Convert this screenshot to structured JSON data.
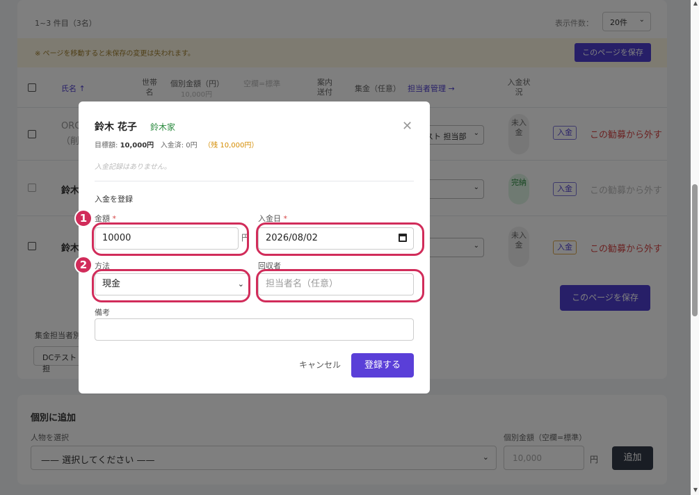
{
  "list": {
    "count_text": "1~3 件目（3名）",
    "per_page_label": "表示件数：",
    "per_page_value": "20件",
    "warning": "※ ページを移動すると未保存の変更は失われます。",
    "save_label": "このページを保存",
    "headers": {
      "name": "氏名 ↑",
      "household": "世帯名",
      "individual_amount": "個別金額（円）",
      "blank_std": "空欄=標準",
      "amount_placeholder": "10,000円",
      "notice": "案内送付",
      "collection": "集金（任意）",
      "manage_link": "担当者管理 →",
      "status": "入金状況"
    },
    "rows": [
      {
        "name_line1": "ORG",
        "name_line2": "（削",
        "select_text": "スト 担当部",
        "status": "未入金",
        "pay_label": "入金",
        "remove_label": "この勧募から外す"
      },
      {
        "name": "鈴木",
        "status": "完納",
        "pay_label": "入金",
        "remove_label": "この勧募から外す"
      },
      {
        "name": "鈴木",
        "status": "未入金",
        "pay_label": "入金",
        "remove_label": "この勧募から外す"
      }
    ],
    "save_bottom_label": "このページを保存",
    "collector_label": "集金担当者別",
    "collector_chip": "DCテスト 担"
  },
  "add": {
    "title": "個別に追加",
    "person_label": "人物を選択",
    "person_placeholder": "—— 選択してください ——",
    "amount_label": "個別金額（空欄=標準）",
    "amount_placeholder": "10,000",
    "yen": "円",
    "add_label": "追加"
  },
  "modal": {
    "name": "鈴木 花子",
    "household": "鈴木家",
    "target_label": "目標額:",
    "target_value": "10,000円",
    "paid_text": "入金済: 0円",
    "remaining": "（残 10,000円）",
    "no_records": "入金記録はありません。",
    "section_title": "入金を登録",
    "amount_label": "金額",
    "date_label": "入金日",
    "required_mark": "*",
    "amount_value": "10000",
    "yen": "円",
    "date_value": "2026/08/02",
    "method_label": "方法",
    "method_value": "現金",
    "collector_label": "回収者",
    "collector_placeholder": "担当者名（任意）",
    "note_label": "備考",
    "note_value": "",
    "cancel_label": "キャンセル",
    "submit_label": "登録する"
  },
  "annotations": {
    "badge1": "1",
    "badge2": "2"
  },
  "icons": {
    "close": "close-icon",
    "calendar": "calendar-icon",
    "chevron": "chevron-down-icon"
  },
  "colors": {
    "accent": "#4f3fd0",
    "highlight": "#d12c5a",
    "success": "#2a8a3e",
    "danger": "#d64545"
  }
}
